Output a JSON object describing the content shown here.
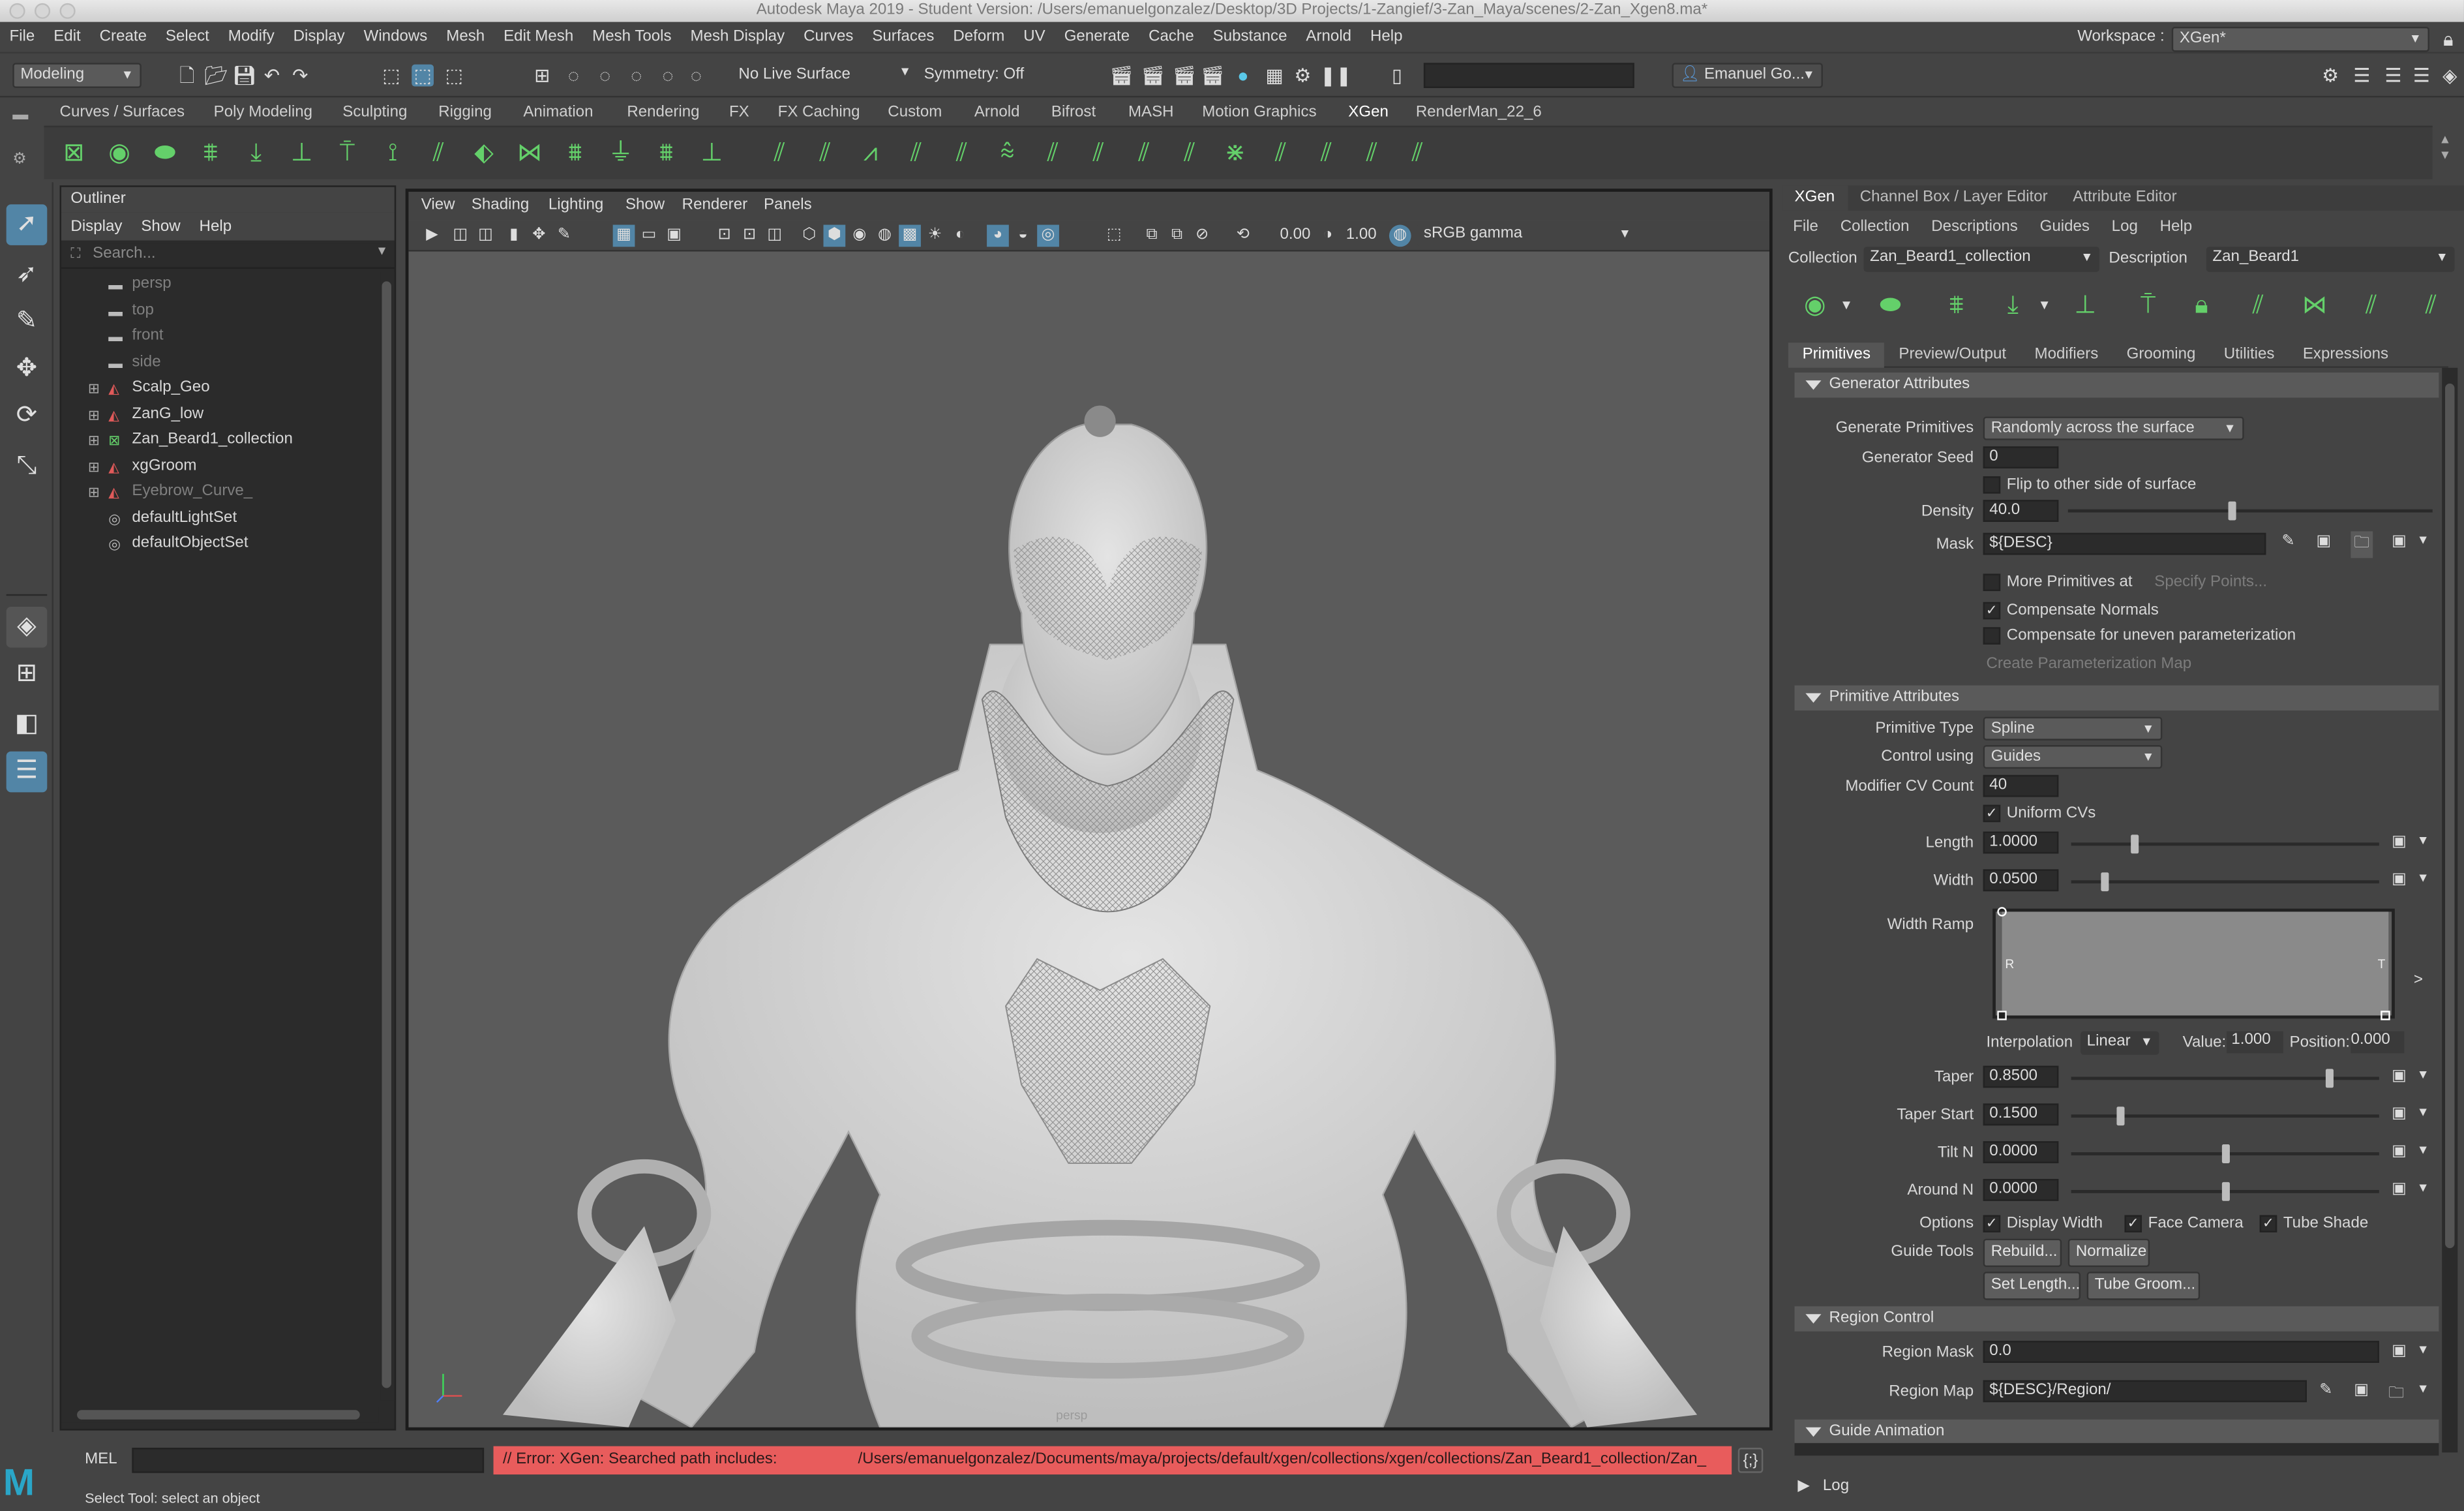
{
  "app": {
    "window_title": "Autodesk Maya 2019 - Student Version: /Users/emanuelgonzalez/Desktop/3D Projects/1-Zangief/3-Zan_Maya/scenes/2-Zan_Xgen8.ma*",
    "menus": [
      "File",
      "Edit",
      "Create",
      "Select",
      "Modify",
      "Display",
      "Windows",
      "Mesh",
      "Edit Mesh",
      "Mesh Tools",
      "Mesh Display",
      "Curves",
      "Surfaces",
      "Deform",
      "UV",
      "Generate",
      "Cache",
      "Substance",
      "Arnold",
      "Help"
    ],
    "workspace_label": "Workspace :",
    "workspace_value": "XGen*"
  },
  "statusline": {
    "menuset": "Modeling",
    "live_surface": "No Live Surface",
    "symmetry": "Symmetry: Off",
    "user": "Emanuel Go..."
  },
  "shelf": {
    "tabs": [
      "Curves / Surfaces",
      "Poly Modeling",
      "Sculpting",
      "Rigging",
      "Animation",
      "Rendering",
      "FX",
      "FX Caching",
      "Custom",
      "Arnold",
      "Bifrost",
      "MASH",
      "Motion Graphics",
      "XGen",
      "RenderMan_22_6"
    ],
    "active_tab": "XGen"
  },
  "outliner": {
    "title": "Outliner",
    "menus": [
      "Display",
      "Show",
      "Help"
    ],
    "search_placeholder": "Search...",
    "items": [
      {
        "label": "persp",
        "type": "camera",
        "dim": true
      },
      {
        "label": "top",
        "type": "camera",
        "dim": true
      },
      {
        "label": "front",
        "type": "camera",
        "dim": true
      },
      {
        "label": "side",
        "type": "camera",
        "dim": true
      },
      {
        "label": "Scalp_Geo",
        "type": "mesh",
        "dim": false
      },
      {
        "label": "ZanG_low",
        "type": "mesh",
        "dim": false
      },
      {
        "label": "Zan_Beard1_collection",
        "type": "xgen",
        "dim": false
      },
      {
        "label": "xgGroom",
        "type": "mesh",
        "dim": false
      },
      {
        "label": "Eyebrow_Curve_",
        "type": "mesh",
        "dim": true
      },
      {
        "label": "defaultLightSet",
        "type": "set",
        "dim": false
      },
      {
        "label": "defaultObjectSet",
        "type": "set",
        "dim": false
      }
    ]
  },
  "viewport": {
    "menus": [
      "View",
      "Shading",
      "Lighting",
      "Show",
      "Renderer",
      "Panels"
    ],
    "field_a": "0.00",
    "field_b": "1.00",
    "color_space": "sRGB gamma",
    "camera_label": "persp"
  },
  "xgen": {
    "tabs": [
      "XGen",
      "Channel Box / Layer Editor",
      "Attribute Editor"
    ],
    "menus": [
      "File",
      "Collection",
      "Descriptions",
      "Guides",
      "Log",
      "Help"
    ],
    "collection_label": "Collection",
    "collection_value": "Zan_Beard1_collection",
    "description_label": "Description",
    "description_value": "Zan_Beard1",
    "subtabs": [
      "Primitives",
      "Preview/Output",
      "Modifiers",
      "Grooming",
      "Utilities",
      "Expressions"
    ],
    "generator": {
      "section": "Generator Attributes",
      "gen_prims_label": "Generate Primitives",
      "gen_prims_value": "Randomly across the surface",
      "seed_label": "Generator Seed",
      "seed_value": "0",
      "flip_label": "Flip to other side of surface",
      "density_label": "Density",
      "density_value": "40.0",
      "density_level": 0.45,
      "mask_label": "Mask",
      "mask_value": "${DESC}",
      "more_prims_label": "More Primitives at",
      "specify_points": "Specify Points...",
      "comp_normals": "Compensate Normals",
      "comp_uneven": "Compensate for uneven parameterization",
      "create_param_map": "Create Parameterization Map"
    },
    "primitive": {
      "section": "Primitive Attributes",
      "type_label": "Primitive Type",
      "type_value": "Spline",
      "control_label": "Control using",
      "control_value": "Guides",
      "cv_label": "Modifier CV Count",
      "cv_value": "40",
      "uniform_cvs": "Uniform CVs",
      "length_label": "Length",
      "length_value": "1.0000",
      "length_level": 0.2,
      "width_label": "Width",
      "width_value": "0.0500",
      "width_level": 0.1,
      "width_ramp_label": "Width Ramp",
      "ramp_left": "R",
      "ramp_right": "T",
      "interp_label": "Interpolation",
      "interp_value": "Linear",
      "value_label": "Value:",
      "value_value": "1.000",
      "position_label": "Position:",
      "position_value": "0.000",
      "taper_label": "Taper",
      "taper_value": "0.8500",
      "taper_level": 0.85,
      "taper_start_label": "Taper Start",
      "taper_start_value": "0.1500",
      "taper_start_level": 0.15,
      "tilt_label": "Tilt N",
      "tilt_value": "0.0000",
      "tilt_level": 0.5,
      "around_label": "Around N",
      "around_value": "0.0000",
      "around_level": 0.5,
      "options_label": "Options",
      "opt_display_width": "Display Width",
      "opt_face_camera": "Face Camera",
      "opt_tube_shade": "Tube Shade",
      "guide_tools_label": "Guide Tools",
      "rebuild": "Rebuild...",
      "normalize": "Normalize",
      "set_length": "Set Length...",
      "tube_groom": "Tube Groom..."
    },
    "region": {
      "section": "Region Control",
      "mask_label": "Region Mask",
      "mask_value": "0.0",
      "map_label": "Region Map",
      "map_value": "${DESC}/Region/"
    },
    "guide_anim_section": "Guide Animation",
    "log_label": "Log"
  },
  "bottom": {
    "mel_label": "MEL",
    "error_prefix": "// Error: XGen:  Searched path includes:",
    "error_path": "/Users/emanuelgonzalez/Documents/maya/projects/default/xgen/collections/xgen/collections/Zan_Beard1_collection/Zan_",
    "help_line": "Select Tool: select an object"
  },
  "colors": {
    "accent_blue": "#5285a6",
    "error_red": "#e85c5c",
    "xgen_green": "#64d06a"
  }
}
